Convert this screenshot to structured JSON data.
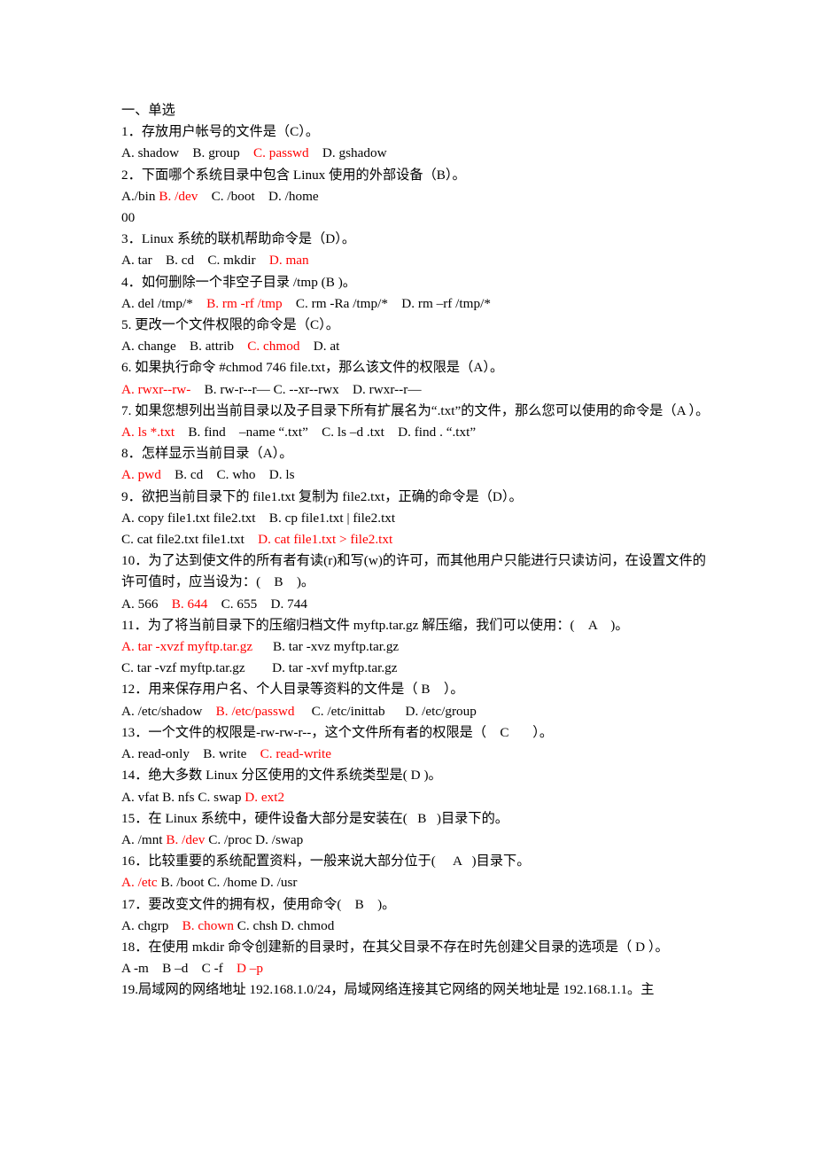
{
  "document": {
    "section_heading": "一、单选",
    "lines": [
      {
        "id": "heading",
        "type": "heading",
        "runs": [
          {
            "t": "一、单选",
            "c": "black"
          }
        ]
      },
      {
        "id": "q1-stem",
        "type": "stem",
        "runs": [
          {
            "t": "1．存放用户帐号的文件是（C）。",
            "c": "black"
          }
        ]
      },
      {
        "id": "q1-opts",
        "type": "options",
        "runs": [
          {
            "t": "A. shadow    B. group    ",
            "c": "black"
          },
          {
            "t": "C. passwd",
            "c": "red"
          },
          {
            "t": "    D. gshadow",
            "c": "black"
          }
        ]
      },
      {
        "id": "q2-stem",
        "type": "stem",
        "runs": [
          {
            "t": "2．下面哪个系统目录中包含 Linux 使用的外部设备（B）。",
            "c": "black"
          }
        ]
      },
      {
        "id": "q2-opts",
        "type": "options",
        "runs": [
          {
            "t": "A./bin ",
            "c": "black"
          },
          {
            "t": "B. /dev",
            "c": "red"
          },
          {
            "t": "    C. /boot    D. /home",
            "c": "black"
          }
        ]
      },
      {
        "id": "stray-00",
        "type": "stray",
        "runs": [
          {
            "t": "00",
            "c": "black"
          }
        ]
      },
      {
        "id": "q3-stem",
        "type": "stem",
        "runs": [
          {
            "t": "3．Linux 系统的联机帮助命令是（D）。",
            "c": "black"
          }
        ]
      },
      {
        "id": "q3-opts",
        "type": "options",
        "runs": [
          {
            "t": "A. tar    B. cd    C. mkdir    ",
            "c": "black"
          },
          {
            "t": "D. man",
            "c": "red"
          }
        ]
      },
      {
        "id": "q4-stem",
        "type": "stem",
        "runs": [
          {
            "t": "4．如何删除一个非空子目录 /tmp (B )。",
            "c": "black"
          }
        ]
      },
      {
        "id": "q4-opts",
        "type": "options",
        "runs": [
          {
            "t": "A. del /tmp/*    ",
            "c": "black"
          },
          {
            "t": "B. rm -rf /tmp",
            "c": "red"
          },
          {
            "t": "    C. rm -Ra /tmp/*    D. rm –rf /tmp/*",
            "c": "black"
          }
        ]
      },
      {
        "id": "q5-stem",
        "type": "stem",
        "runs": [
          {
            "t": "5. 更改一个文件权限的命令是（C）。",
            "c": "black"
          }
        ]
      },
      {
        "id": "q5-opts",
        "type": "options",
        "runs": [
          {
            "t": "A. change    B. attrib    ",
            "c": "black"
          },
          {
            "t": "C. chmod",
            "c": "red"
          },
          {
            "t": "    D. at",
            "c": "black"
          }
        ]
      },
      {
        "id": "q6-stem",
        "type": "stem",
        "runs": [
          {
            "t": "6. 如果执行命令 #chmod 746 file.txt，那么该文件的权限是（A）。",
            "c": "black"
          }
        ]
      },
      {
        "id": "q6-opts",
        "type": "options",
        "runs": [
          {
            "t": "A. rwxr--rw-",
            "c": "red"
          },
          {
            "t": "    B. rw-r--r— C. --xr--rwx    D. rwxr--r—",
            "c": "black"
          }
        ]
      },
      {
        "id": "q7-stem",
        "type": "stem",
        "runs": [
          {
            "t": "7. 如果您想列出当前目录以及子目录下所有扩展名为“.txt”的文件，那么您可以使用的命令是（A ）。",
            "c": "black"
          }
        ]
      },
      {
        "id": "q7-opts",
        "type": "options",
        "runs": [
          {
            "t": "A. ls *.txt",
            "c": "red"
          },
          {
            "t": "    B. find    –name “.txt”    C. ls –d .txt    D. find . “.txt”",
            "c": "black"
          }
        ]
      },
      {
        "id": "q8-stem",
        "type": "stem",
        "runs": [
          {
            "t": "8．怎样显示当前目录（A）。",
            "c": "black"
          }
        ]
      },
      {
        "id": "q8-opts",
        "type": "options",
        "runs": [
          {
            "t": "A. pwd",
            "c": "red"
          },
          {
            "t": "    B. cd    C. who    D. ls",
            "c": "black"
          }
        ]
      },
      {
        "id": "q9-stem",
        "type": "stem",
        "runs": [
          {
            "t": "9．欲把当前目录下的 file1.txt 复制为 file2.txt，正确的命令是（D）。",
            "c": "black"
          }
        ]
      },
      {
        "id": "q9-optsA",
        "type": "options",
        "runs": [
          {
            "t": "A. copy file1.txt file2.txt    B. cp file1.txt | file2.txt",
            "c": "black"
          }
        ]
      },
      {
        "id": "q9-optsB",
        "type": "options",
        "runs": [
          {
            "t": "C. cat file2.txt file1.txt    ",
            "c": "black"
          },
          {
            "t": "D. cat file1.txt > file2.txt",
            "c": "red"
          }
        ]
      },
      {
        "id": "q10-stem",
        "type": "stem",
        "runs": [
          {
            "t": "10．为了达到使文件的所有者有读(r)和写(w)的许可，而其他用户只能进行只读访问，在设置文件的许可值时，应当设为：(    B    )。",
            "c": "black"
          }
        ]
      },
      {
        "id": "q10-opts",
        "type": "options",
        "runs": [
          {
            "t": "A. 566    ",
            "c": "black"
          },
          {
            "t": "B. 644",
            "c": "red"
          },
          {
            "t": "    C. 655    D. 744",
            "c": "black"
          }
        ]
      },
      {
        "id": "q11-stem",
        "type": "stem",
        "runs": [
          {
            "t": "11．为了将当前目录下的压缩归档文件 myftp.tar.gz 解压缩，我们可以使用：(    A    )。",
            "c": "black"
          }
        ]
      },
      {
        "id": "q11-optsA",
        "type": "options",
        "runs": [
          {
            "t": "A. tar -xvzf myftp.tar.gz",
            "c": "red"
          },
          {
            "t": "      B. tar -xvz myftp.tar.gz",
            "c": "black"
          }
        ]
      },
      {
        "id": "q11-optsB",
        "type": "options",
        "runs": [
          {
            "t": "C. tar -vzf myftp.tar.gz        D. tar -xvf myftp.tar.gz",
            "c": "black"
          }
        ]
      },
      {
        "id": "q12-stem",
        "type": "stem",
        "runs": [
          {
            "t": "12．用来保存用户名、个人目录等资料的文件是（ B    ）。",
            "c": "black"
          }
        ]
      },
      {
        "id": "q12-opts",
        "type": "options",
        "runs": [
          {
            "t": "A. /etc/shadow    ",
            "c": "black"
          },
          {
            "t": "B. /etc/passwd",
            "c": "red"
          },
          {
            "t": "     C. /etc/inittab      D. /etc/group",
            "c": "black"
          }
        ]
      },
      {
        "id": "q13-stem",
        "type": "stem",
        "runs": [
          {
            "t": "13．一个文件的权限是-rw-rw-r--，这个文件所有者的权限是（    C       ）。",
            "c": "black"
          }
        ]
      },
      {
        "id": "q13-opts",
        "type": "options",
        "runs": [
          {
            "t": "A. read-only    B. write    ",
            "c": "black"
          },
          {
            "t": "C. read-write",
            "c": "red"
          }
        ]
      },
      {
        "id": "q14-stem",
        "type": "stem",
        "runs": [
          {
            "t": "14．绝大多数 Linux 分区使用的文件系统类型是( D )。",
            "c": "black"
          }
        ]
      },
      {
        "id": "q14-opts",
        "type": "options",
        "runs": [
          {
            "t": "A. vfat B. nfs C. swap ",
            "c": "black"
          },
          {
            "t": "D. ext2",
            "c": "red"
          }
        ]
      },
      {
        "id": "q15-stem",
        "type": "stem",
        "runs": [
          {
            "t": "15．在 Linux 系统中，硬件设备大部分是安装在(   B   )目录下的。",
            "c": "black"
          }
        ]
      },
      {
        "id": "q15-opts",
        "type": "options",
        "runs": [
          {
            "t": "A. /mnt ",
            "c": "black"
          },
          {
            "t": "B. /dev",
            "c": "red"
          },
          {
            "t": " C. /proc D. /swap",
            "c": "black"
          }
        ]
      },
      {
        "id": "q16-stem",
        "type": "stem",
        "runs": [
          {
            "t": "16．比较重要的系统配置资料，一般来说大部分位于(     A   )目录下。",
            "c": "black"
          }
        ]
      },
      {
        "id": "q16-opts",
        "type": "options",
        "runs": [
          {
            "t": "A. /etc",
            "c": "red"
          },
          {
            "t": " B. /boot C. /home D. /usr",
            "c": "black"
          }
        ]
      },
      {
        "id": "q17-stem",
        "type": "stem",
        "runs": [
          {
            "t": "17．要改变文件的拥有权，使用命令(    B    )。",
            "c": "black"
          }
        ]
      },
      {
        "id": "q17-opts",
        "type": "options",
        "runs": [
          {
            "t": "A. chgrp    ",
            "c": "black"
          },
          {
            "t": "B. chown",
            "c": "red"
          },
          {
            "t": " C. chsh D. chmod",
            "c": "black"
          }
        ]
      },
      {
        "id": "q18-stem",
        "type": "stem",
        "runs": [
          {
            "t": "18．在使用 mkdir 命令创建新的目录时，在其父目录不存在时先创建父目录的选项是（ D ）。",
            "c": "black"
          }
        ]
      },
      {
        "id": "q18-opts",
        "type": "options",
        "runs": [
          {
            "t": "A -m    B –d    C -f    ",
            "c": "black"
          },
          {
            "t": "D –p",
            "c": "red"
          }
        ]
      },
      {
        "id": "q19-stem",
        "type": "stem",
        "runs": [
          {
            "t": "19.局域网的网络地址 192.168.1.0/24，局域网络连接其它网络的网关地址是 192.168.1.1。主",
            "c": "black"
          }
        ]
      }
    ]
  },
  "colors": {
    "text": "#000000",
    "answer_red": "#ff0000",
    "page_background": "#ffffff"
  }
}
